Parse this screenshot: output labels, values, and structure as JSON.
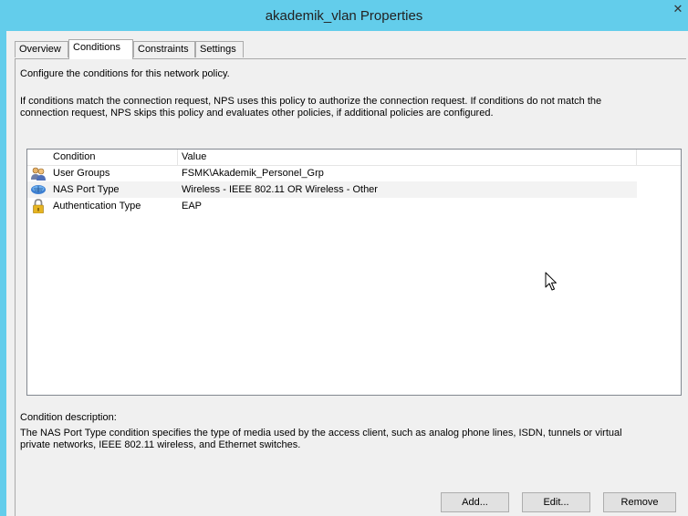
{
  "window": {
    "title": "akademik_vlan Properties",
    "close_glyph": "✕"
  },
  "tabs": [
    {
      "label": "Overview",
      "active": false
    },
    {
      "label": "Conditions",
      "active": true
    },
    {
      "label": "Constraints",
      "active": false
    },
    {
      "label": "Settings",
      "active": false
    }
  ],
  "intro": "Configure the conditions for this network policy.",
  "explanation": {
    "line1": "If conditions match the connection request, NPS uses this policy to authorize the connection request. If conditions do not match the",
    "line2": "connection request, NPS skips this policy and evaluates other policies, if additional policies are configured."
  },
  "conditions_table": {
    "columns": [
      "Condition",
      "Value"
    ],
    "rows": [
      {
        "condition": "User Groups",
        "value": "FSMK\\Akademik_Personel_Grp",
        "icon": "user-group-icon"
      },
      {
        "condition": "NAS Port Type",
        "value": "Wireless - IEEE 802.11 OR Wireless - Other",
        "icon": "network-port-icon",
        "selected": true
      },
      {
        "condition": "Authentication Type",
        "value": "EAP",
        "icon": "lock-icon"
      }
    ]
  },
  "description": {
    "label": "Condition description:",
    "line1": "The NAS Port Type condition specifies the type of media used by the access client, such as analog phone lines, ISDN, tunnels or virtual",
    "line2": "private networks, IEEE 802.11 wireless, and Ethernet switches."
  },
  "buttons": {
    "add": "Add...",
    "edit": "Edit...",
    "remove": "Remove"
  },
  "colors": {
    "titlebar": "#63cdeb",
    "selected_row": "#f3f3f3",
    "list_border": "#828790"
  }
}
